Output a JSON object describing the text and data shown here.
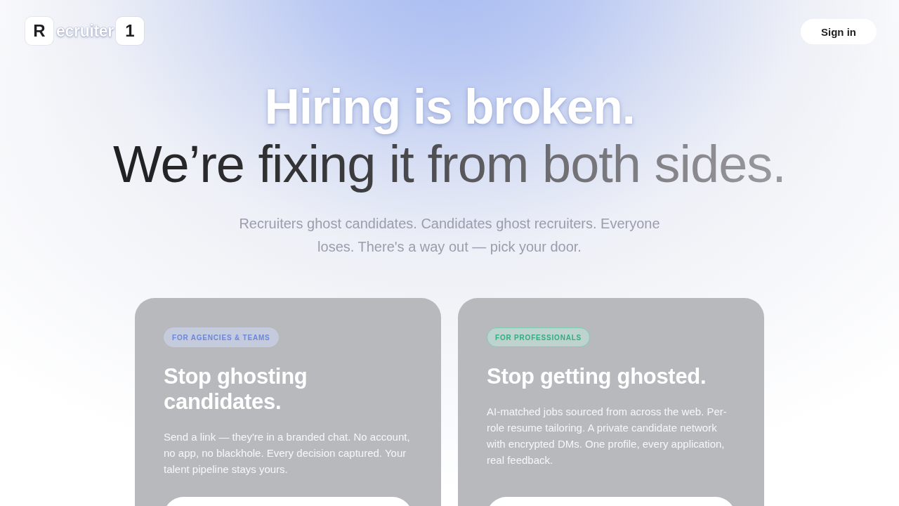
{
  "header": {
    "logo": {
      "first_letter": "R",
      "middle": "ecruiter",
      "last": "1"
    },
    "sign_in": "Sign in"
  },
  "hero": {
    "headline": "Hiring is broken.",
    "subheadline": "We’re fixing it from both sides.",
    "description": "Recruiters ghost candidates. Candidates ghost recruiters. Everyone loses. There's a way out — pick your door."
  },
  "cards": [
    {
      "kind": "agencies",
      "badge": "FOR AGENCIES & TEAMS",
      "title": "Stop ghosting candidates.",
      "body": "Send a link — they're in a branded chat. No account, no app, no blackhole. Every decision captured. Your talent pipeline stays yours."
    },
    {
      "kind": "professionals",
      "badge": "FOR PROFESSIONALS",
      "title": "Stop getting ghosted.",
      "body": "AI-matched jobs sourced from across the web. Per-role resume tailoring. A private candidate network with encrypted DMs. One profile, every application, real feedback."
    }
  ]
}
